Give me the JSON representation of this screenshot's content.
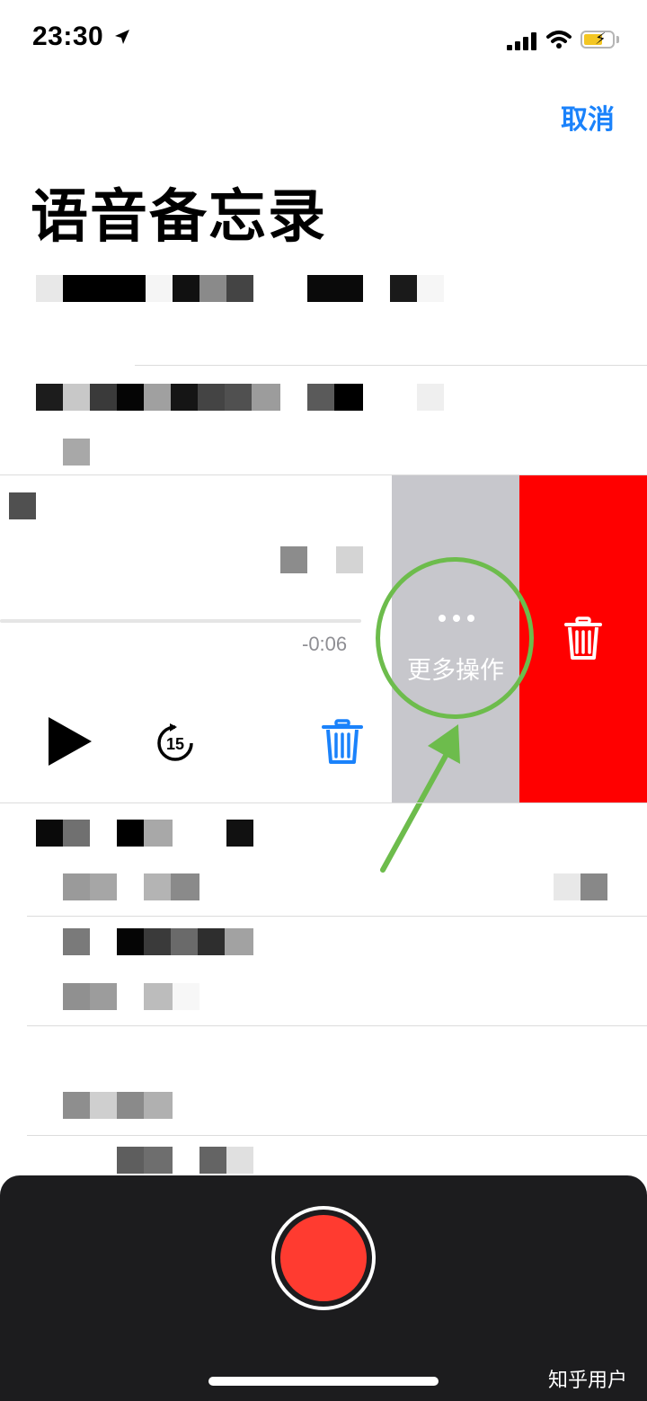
{
  "status": {
    "time": "23:30"
  },
  "header": {
    "cancel_label": "取消",
    "title": "语音备忘录"
  },
  "expanded": {
    "remaining": "-0:06",
    "skip_label": "15"
  },
  "swipe_actions": {
    "more_label": "更多操作",
    "more_color": "#c7c7cc",
    "delete_color": "#ff0000"
  },
  "annotation": {
    "circle_color": "#6dbc4c"
  },
  "bottom": {
    "record_color": "#ff3b30"
  },
  "watermark": "知乎用户"
}
